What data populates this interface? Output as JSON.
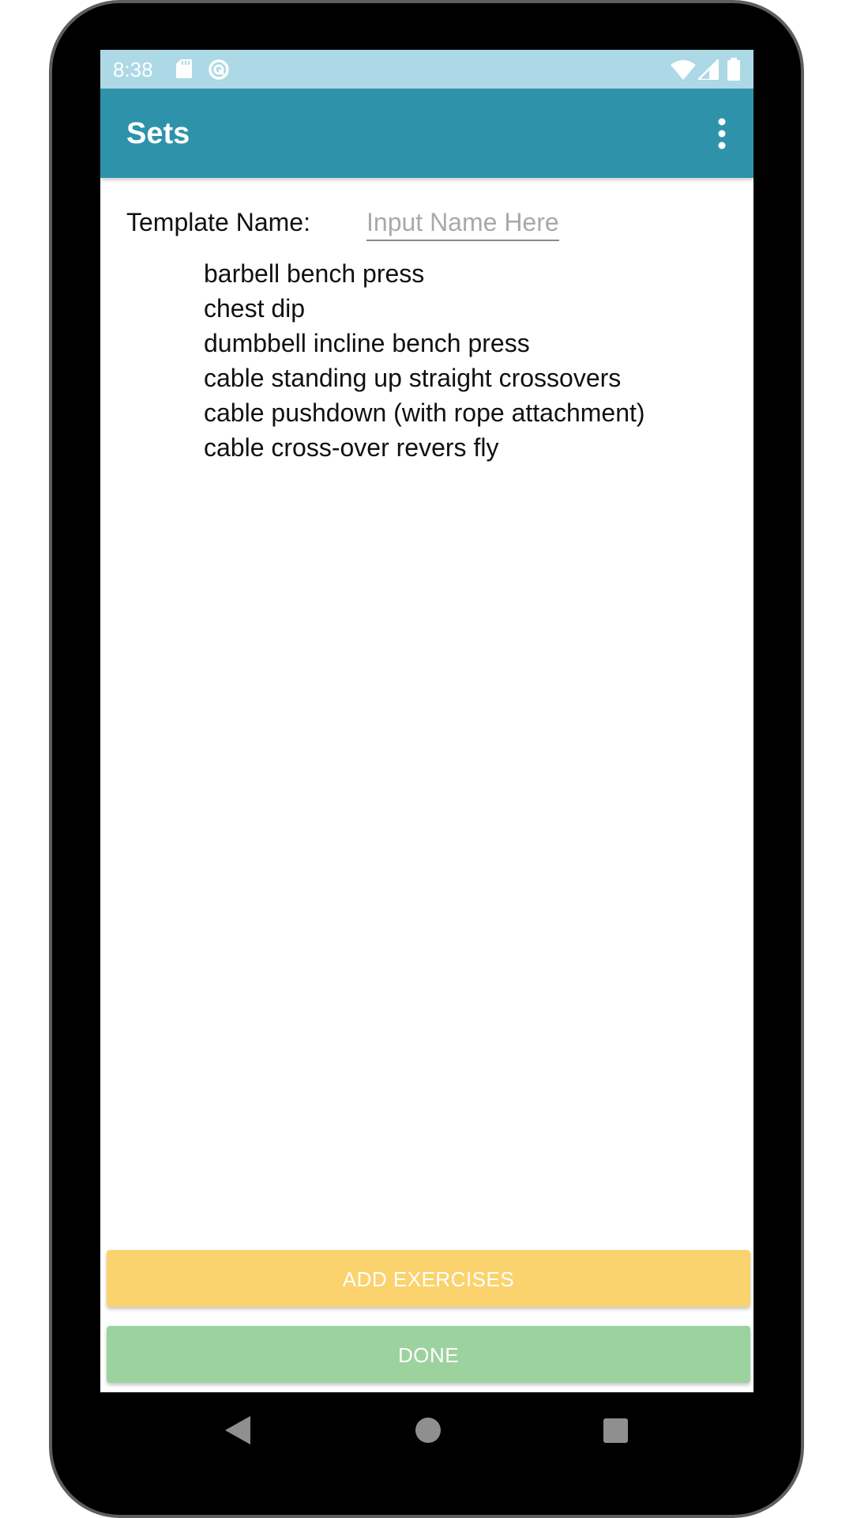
{
  "status_bar": {
    "time": "8:38",
    "icons": [
      "sd-card-icon",
      "sync-icon",
      "wifi-icon",
      "cell-signal-icon",
      "battery-icon"
    ]
  },
  "app_bar": {
    "title": "Sets",
    "menu_icon": "more-vert-icon"
  },
  "form": {
    "template_label": "Template Name:",
    "template_value": "",
    "template_placeholder": "Input Name Here"
  },
  "exercises": [
    "barbell bench press",
    "chest dip",
    "dumbbell incline bench press",
    "cable standing up straight crossovers",
    "cable pushdown (with rope attachment)",
    "cable cross-over revers fly"
  ],
  "buttons": {
    "add_exercises": "ADD EXERCISES",
    "done": "DONE"
  },
  "nav_bar": {
    "icons": [
      "back-icon",
      "home-icon",
      "recents-icon"
    ]
  },
  "colors": {
    "status_bar": "#add8e6",
    "app_bar": "#2e93aa",
    "add_button": "#fad36e",
    "done_button": "#9cd29e"
  }
}
